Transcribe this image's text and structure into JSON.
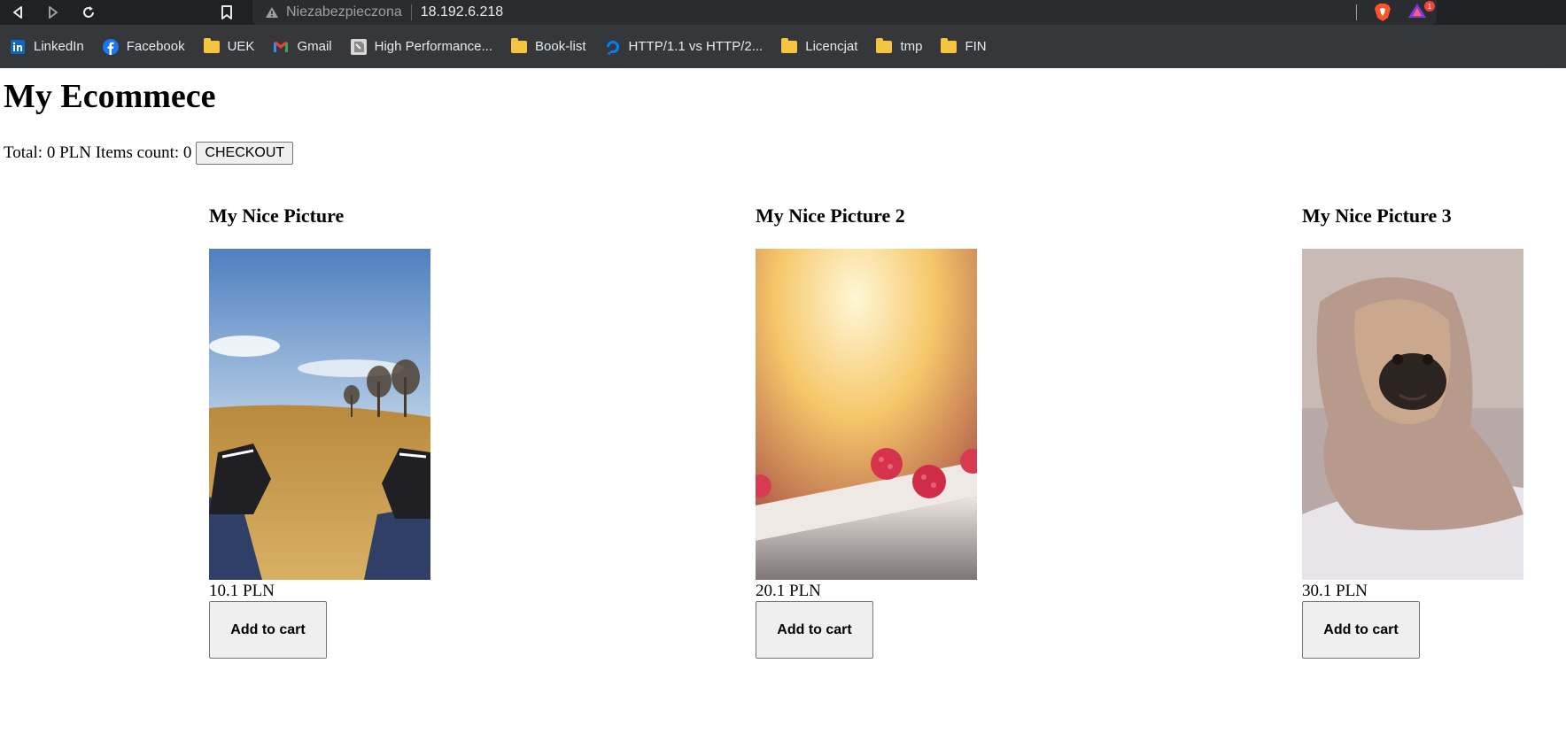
{
  "browser": {
    "address": {
      "security_label": "Niezabezpieczona",
      "url": "18.192.6.218"
    },
    "rewards_badge_count": "1",
    "bookmarks": [
      {
        "label": "LinkedIn",
        "icon": "linkedin-icon"
      },
      {
        "label": "Facebook",
        "icon": "facebook-icon"
      },
      {
        "label": "UEK",
        "icon": "folder-icon"
      },
      {
        "label": "Gmail",
        "icon": "gmail-icon"
      },
      {
        "label": "High Performance...",
        "icon": "page-icon"
      },
      {
        "label": "Book-list",
        "icon": "folder-icon"
      },
      {
        "label": "HTTP/1.1 vs HTTP/2...",
        "icon": "digitalocean-icon"
      },
      {
        "label": "Licencjat",
        "icon": "folder-icon"
      },
      {
        "label": "tmp",
        "icon": "folder-icon"
      },
      {
        "label": "FIN",
        "icon": "folder-icon"
      }
    ]
  },
  "page": {
    "title": "My Ecommece",
    "summary": {
      "total_label": "Total:",
      "total_value": "0",
      "currency": "PLN",
      "items_label": "Items count:",
      "items_value": "0",
      "checkout_label": "CHECKOUT"
    },
    "products": [
      {
        "name": "My Nice Picture",
        "price": "10.1 PLN",
        "button": "Add to cart",
        "image": "field-with-sneakers-photo"
      },
      {
        "name": "My Nice Picture 2",
        "price": "20.1 PLN",
        "button": "Add to cart",
        "image": "raspberries-photo"
      },
      {
        "name": "My Nice Picture 3",
        "price": "30.1 PLN",
        "button": "Add to cart",
        "image": "pug-in-blanket-photo"
      }
    ]
  },
  "colors": {
    "toolbar_bg": "#202124",
    "bookmarks_bg": "#36373a",
    "folder": "#f5c542",
    "button_bg": "#efefef"
  }
}
